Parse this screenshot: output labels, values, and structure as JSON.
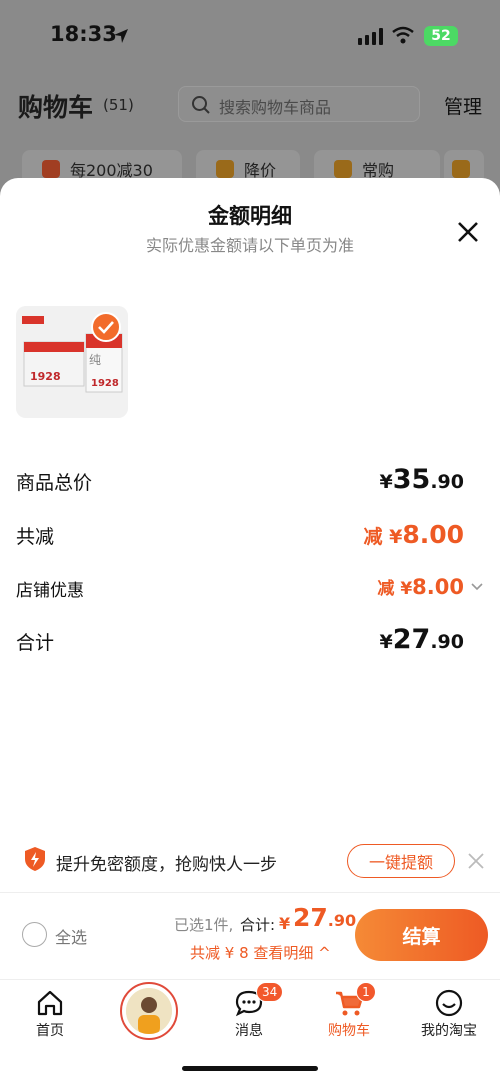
{
  "status": {
    "time": "18:33",
    "battery": "52"
  },
  "header": {
    "title": "购物车",
    "count": "(51)",
    "search_placeholder": "搜索购物车商品",
    "manage_label": "管理"
  },
  "chips": [
    {
      "label": "每200减30"
    },
    {
      "label": "降价"
    },
    {
      "label": "常购"
    }
  ],
  "sheet": {
    "title": "金额明细",
    "subtitle": "实际优惠金额请以下单页为准",
    "rows": {
      "goods_total": {
        "label": "商品总价",
        "currency": "¥",
        "int": "35",
        "dec": ".90"
      },
      "reduction": {
        "label": "共减",
        "prefix": "减 ¥",
        "value": "8.00"
      },
      "shop_discount": {
        "label": "店铺优惠",
        "prefix": "减 ¥",
        "value": "8.00"
      },
      "total": {
        "label": "合计",
        "currency": "¥",
        "int": "27",
        "dec": ".90"
      }
    }
  },
  "promo": {
    "text": "提升免密额度，抢购快人一步",
    "button": "一键提额"
  },
  "checkout": {
    "select_all": "全选",
    "selected": "已选1件,",
    "total_label": "合计:",
    "currency": "¥",
    "total_int": "27",
    "total_dec": ".90",
    "detail": "共减 ¥ 8  查看明细 ^",
    "button": "结算"
  },
  "tabs": {
    "home": "首页",
    "messages": "消息",
    "messages_badge": "34",
    "cart": "购物车",
    "cart_badge": "1",
    "mine": "我的淘宝"
  },
  "colors": {
    "accent": "#ee5a24",
    "badge": "#f2582c"
  }
}
